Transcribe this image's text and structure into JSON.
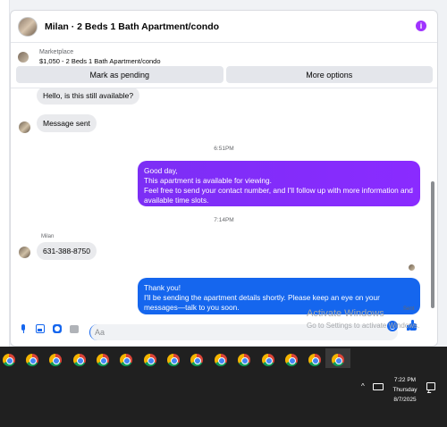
{
  "header": {
    "title": "Milan · 2 Beds 1 Bath Apartment/condo",
    "info_icon": "info-icon"
  },
  "marketplace": {
    "label": "Marketplace",
    "listing": "$1,050 - 2 Beds 1 Bath Apartment/condo"
  },
  "actions": {
    "mark_pending": "Mark as pending",
    "more_options": "More options"
  },
  "messages": {
    "m1": "Hello, is this still available?",
    "m2": "Message sent",
    "ts1": "6:51PM",
    "out1_line1": "Good day,",
    "out1_line2": "This apartment is available for viewing.",
    "out1_line3": "Feel free to send your contact number, and I'll follow up with more information and available time slots.",
    "ts2": "7:14PM",
    "sender": "Milan",
    "m3": "631-388-8750",
    "out2_line1": "Thank you!",
    "out2_line2": "I'll be sending the apartment details shortly. Please keep an eye on your messages—talk to you soon.",
    "status": "Sent"
  },
  "composer": {
    "placeholder": "Aa"
  },
  "watermark": {
    "title": "Activate Windows",
    "subtitle": "Go to Settings to activate Windows."
  },
  "taskbar": {
    "time": "7:22 PM",
    "day": "Thursday",
    "date": "8/7/2025",
    "chevron": "^"
  },
  "colors": {
    "accent_blue": "#1566ee",
    "accent_purple": "#8a2bff",
    "bubble_gray": "#e9eaed"
  }
}
